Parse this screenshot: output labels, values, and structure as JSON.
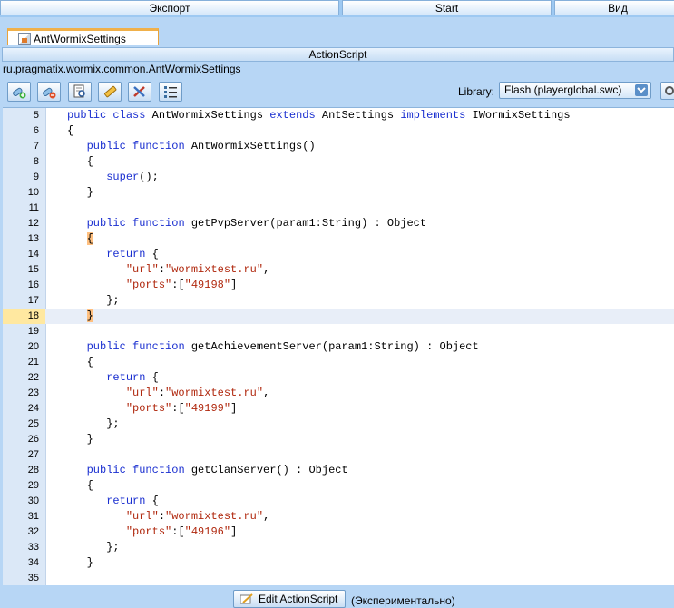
{
  "menubar": {
    "items": [
      {
        "label": "Экспорт"
      },
      {
        "label": "Start"
      },
      {
        "label": "Вид"
      }
    ]
  },
  "file_tab": {
    "label": "AntWormixSettings"
  },
  "panel": {
    "title": "ActionScript"
  },
  "class_path": "ru.pragmatix.wormix.common.AntWormixSettings",
  "toolbar": {
    "buttons": [
      {
        "icon": "add-script-icon"
      },
      {
        "icon": "remove-script-icon"
      },
      {
        "icon": "find-icon"
      },
      {
        "icon": "edit-pencil-icon"
      },
      {
        "icon": "tools-icon"
      },
      {
        "icon": "list-icon"
      }
    ],
    "library_label": "Library:",
    "library_value": "Flash (playerglobal.swc)"
  },
  "editor": {
    "current_line": "18",
    "lines": [
      {
        "n": "5",
        "code": "public class AntWormixSettings extends AntSettings implements IWormixSettings"
      },
      {
        "n": "6",
        "code": "{"
      },
      {
        "n": "7",
        "code": "   public function AntWormixSettings()"
      },
      {
        "n": "8",
        "code": "   {"
      },
      {
        "n": "9",
        "code": "      super();"
      },
      {
        "n": "10",
        "code": "   }"
      },
      {
        "n": "11",
        "code": ""
      },
      {
        "n": "12",
        "code": "   public function getPvpServer(param1:String) : Object"
      },
      {
        "n": "13",
        "code": "   {"
      },
      {
        "n": "14",
        "code": "      return {"
      },
      {
        "n": "15",
        "code": "         \"url\":\"wormixtest.ru\","
      },
      {
        "n": "16",
        "code": "         \"ports\":[\"49198\"]"
      },
      {
        "n": "17",
        "code": "      };"
      },
      {
        "n": "18",
        "code": "   }"
      },
      {
        "n": "19",
        "code": ""
      },
      {
        "n": "20",
        "code": "   public function getAchievementServer(param1:String) : Object"
      },
      {
        "n": "21",
        "code": "   {"
      },
      {
        "n": "22",
        "code": "      return {"
      },
      {
        "n": "23",
        "code": "         \"url\":\"wormixtest.ru\","
      },
      {
        "n": "24",
        "code": "         \"ports\":[\"49199\"]"
      },
      {
        "n": "25",
        "code": "      };"
      },
      {
        "n": "26",
        "code": "   }"
      },
      {
        "n": "27",
        "code": ""
      },
      {
        "n": "28",
        "code": "   public function getClanServer() : Object"
      },
      {
        "n": "29",
        "code": "   {"
      },
      {
        "n": "30",
        "code": "      return {"
      },
      {
        "n": "31",
        "code": "         \"url\":\"wormixtest.ru\","
      },
      {
        "n": "32",
        "code": "         \"ports\":[\"49196\"]"
      },
      {
        "n": "33",
        "code": "      };"
      },
      {
        "n": "34",
        "code": "   }"
      },
      {
        "n": "35",
        "code": ""
      }
    ]
  },
  "footer": {
    "edit_button": "Edit ActionScript",
    "note": "(Экспериментально)"
  },
  "colors": {
    "keyword": "#1a2fd0",
    "string": "#b0280e",
    "bracket_highlight": "#ffc080"
  }
}
